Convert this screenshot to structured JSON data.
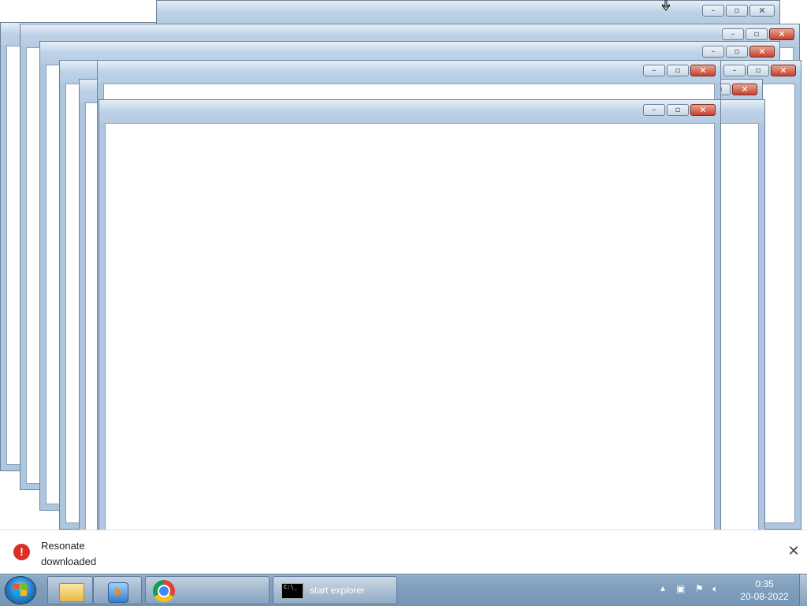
{
  "download_bar": {
    "message_line1": "Resonate",
    "message_line2": "downloaded",
    "close_glyph": "✕",
    "warning_glyph": "!"
  },
  "window_controls": {
    "minimize": "–",
    "maximize": "▫",
    "close": "✕"
  },
  "taskbar": {
    "cmd_window_label": "start  explorer",
    "cmd_icon_text": "C:\\_",
    "pinned": [
      "windows-explorer-icon",
      "media-player-icon",
      "chrome-icon"
    ]
  },
  "tray": {
    "time": "0:35",
    "date": "20-08-2022"
  },
  "colors": {
    "frame": "#aec6df",
    "close_button": "#c7412b",
    "taskbar": "#7f9dbc",
    "error_badge": "#d93025"
  }
}
